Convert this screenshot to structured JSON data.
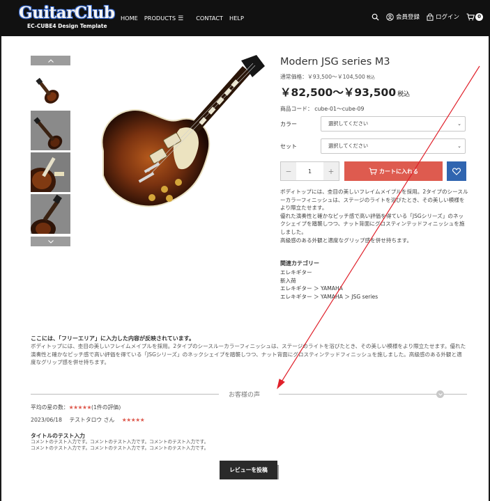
{
  "header": {
    "logo_main": "GuitarClub",
    "logo_sub": "EC-CUBE4 Design Template",
    "nav": [
      "HOME",
      "PRODUCTS",
      "CONTACT",
      "HELP"
    ],
    "member_label": "会員登録",
    "login_label": "ログイン",
    "cart_count": "0"
  },
  "product": {
    "name": "Modern JSG series M3",
    "normal_price_label": "通常価格：￥93,500～￥104,500",
    "normal_price_tax": "税込",
    "price": "￥82,500～￥93,500",
    "price_tax": "税込",
    "code": "商品コード： cube-01～cube-09",
    "options": [
      {
        "label": "カラー",
        "value": "選択してください"
      },
      {
        "label": "セット",
        "value": "選択してください"
      }
    ],
    "quantity": "1",
    "qty_minus": "－",
    "qty_plus": "＋",
    "cart_button": "カートに入れる",
    "description": [
      "ボディトップには、杢目の美しいフレイムメイプルを採用。2タイプのシースルーカラーフィニッシュは、ステージのライトを浴びたとき、その美しい模様をより際立たせます。",
      "優れた演奏性と確かなピッチ感で高い評価を得ている「JSGシリーズ」のネックシェイプを踏襲しつつ、ナット背面にグロスティンテッドフィニッシュを施しました。",
      "高級感のある外観と適度なグリップ感を併せ持ちます。"
    ],
    "category_heading": "関連カテゴリー",
    "categories": [
      "エレキギター",
      "新入荷",
      "エレキギター ＞ YAMAHA",
      "エレキギター ＞ YAMAHA ＞ JSG series"
    ]
  },
  "free_area": {
    "title": "ここには、「フリーエリア」に入力した内容が反映されています。",
    "text": "ボディトップには、杢目の美しいフレイムメイプルを採用。2タイプのシースルーカラーフィニッシュは、ステージのライトを浴びたとき、その美しい模様をより際立たせます。優れた演奏性と確かなピッチ感で高い評価を得ている「JSGシリーズ」のネックシェイプを踏襲しつつ、ナット背面にグロスティンテッドフィニッシュを施しました。高級感のある外観と適度なグリップ感を併せ持ちます。"
  },
  "reviews": {
    "section_title": "お客様の声",
    "average_label": "平均の星の数：",
    "average_stars": "★★★★★",
    "average_count": "(1件の評価)",
    "average_rating": 5,
    "items": [
      {
        "date": "2023/06/18",
        "reviewer": "テストタロウ さん",
        "stars": "★★★★★",
        "title": "タイトルのテスト入力",
        "body_lines": [
          "コメントのテスト入力です。コメントのテスト入力です。コメントのテスト入力です。",
          "コメントのテスト入力です。コメントのテスト入力です。コメントのテスト入力です。"
        ]
      }
    ],
    "post_button": "レビューを投稿"
  },
  "colors": {
    "header_bg": "#111111",
    "accent_red": "#de5b4f",
    "favorite_blue": "#3065b0",
    "annotation_red": "#e0202a"
  },
  "icons": {
    "thumb_up": "chevron-up-icon",
    "thumb_down": "chevron-down-icon",
    "search": "search-icon",
    "member": "user-circle-icon",
    "login": "lock-icon",
    "cart": "cart-icon",
    "favorite": "heart-icon"
  }
}
